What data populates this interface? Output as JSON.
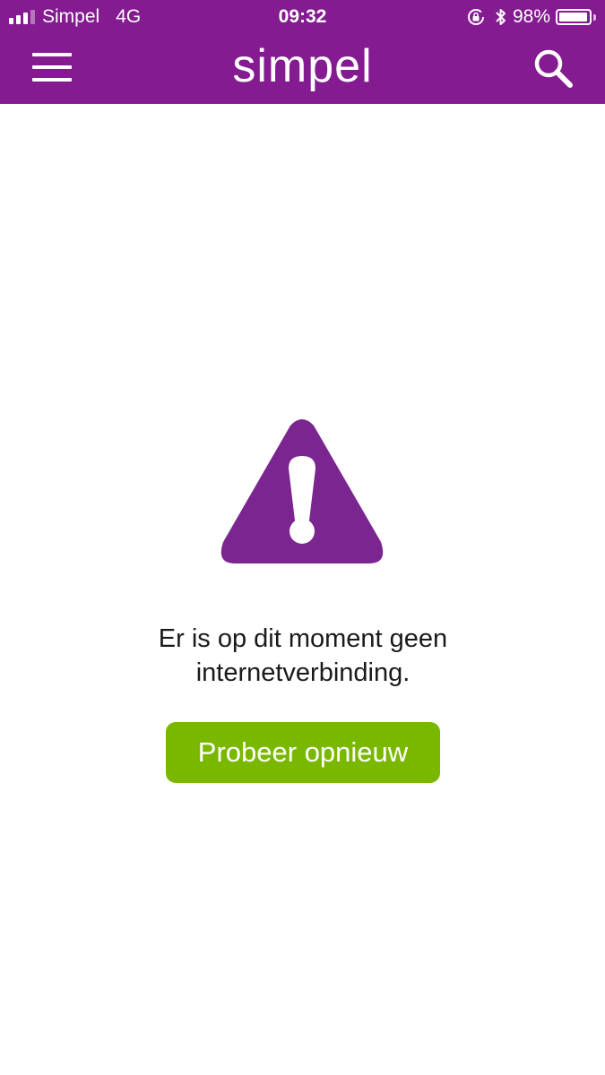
{
  "status_bar": {
    "carrier": "Simpel",
    "network": "4G",
    "time": "09:32",
    "battery_percent": "98%",
    "battery_level": 0.98,
    "signal_bars_filled": 3,
    "signal_bars_total": 4,
    "icons": [
      "signal-icon",
      "rotation-lock-icon",
      "bluetooth-icon",
      "battery-icon"
    ]
  },
  "header": {
    "brand": "simpel",
    "menu_icon": "hamburger-menu-icon",
    "search_icon": "search-icon"
  },
  "error": {
    "icon": "warning-triangle-icon",
    "message_line1": "Er is op dit moment geen",
    "message_line2": "internetverbinding.",
    "retry_label": "Probeer opnieuw"
  },
  "colors": {
    "brand_purple": "#851b91",
    "warning_purple": "#7a2590",
    "button_green": "#7ab800",
    "background": "#ffffff"
  }
}
